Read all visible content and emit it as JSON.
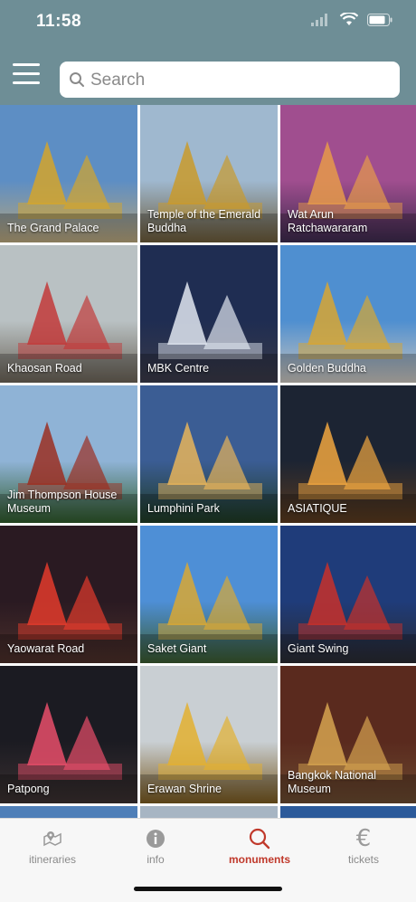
{
  "status": {
    "time": "11:58"
  },
  "header": {
    "search_placeholder": "Search"
  },
  "monuments": [
    {
      "label": "The Grand Palace",
      "sky": "#5d8ec4",
      "ground": "#b7a47a",
      "accent": "#d4a52b"
    },
    {
      "label": "Temple of the Emerald Buddha",
      "sky": "#9fb8cf",
      "ground": "#6b5a38",
      "accent": "#c99a2c"
    },
    {
      "label": "Wat Arun Ratchawararam",
      "sky": "#a04e8f",
      "ground": "#3c2a4d",
      "accent": "#e69a4a"
    },
    {
      "label": "Khaosan Road",
      "sky": "#b9c1c3",
      "ground": "#6b6357",
      "accent": "#c23a3a"
    },
    {
      "label": "MBK Centre",
      "sky": "#1f2d52",
      "ground": "#3a3a48",
      "accent": "#e0e6f0"
    },
    {
      "label": "Golden Buddha",
      "sky": "#4f8fd0",
      "ground": "#c9c4bd",
      "accent": "#d7a632"
    },
    {
      "label": "Jim Thompson House Museum",
      "sky": "#8fb3d6",
      "ground": "#2f5a2a",
      "accent": "#9b2f22"
    },
    {
      "label": "Lumphini Park",
      "sky": "#3b5d94",
      "ground": "#1e3a22",
      "accent": "#e7b45a"
    },
    {
      "label": "ASIATIQUE",
      "sky": "#1c2433",
      "ground": "#5a3a1e",
      "accent": "#f0a640"
    },
    {
      "label": "Yaowarat  Road",
      "sky": "#2a1a22",
      "ground": "#4b2f2a",
      "accent": "#e33b2c"
    },
    {
      "label": "Saket Giant",
      "sky": "#4e8fd6",
      "ground": "#3a5a2e",
      "accent": "#d9a834"
    },
    {
      "label": "Giant Swing",
      "sky": "#1f3c7a",
      "ground": "#2a2a30",
      "accent": "#c8302a"
    },
    {
      "label": "Patpong",
      "sky": "#1b1b22",
      "ground": "#3a3030",
      "accent": "#e84d6a"
    },
    {
      "label": "Erawan Shrine",
      "sky": "#c9cfd3",
      "ground": "#7a5a20",
      "accent": "#e3b030"
    },
    {
      "label": "Bangkok National Museum",
      "sky": "#5a2a1e",
      "ground": "#6a4a30",
      "accent": "#d6a350"
    },
    {
      "label": "",
      "sky": "#4f7fb8",
      "ground": "#4f7fb8",
      "accent": "#d9b14a"
    },
    {
      "label": "",
      "sky": "#a7b5c3",
      "ground": "#a7b5c3",
      "accent": "#e0e0e0"
    },
    {
      "label": "",
      "sky": "#2c5a9a",
      "ground": "#2c5a9a",
      "accent": "#c8302a"
    }
  ],
  "tabs": [
    {
      "label": "itineraries",
      "icon": "map-pin-icon",
      "active": false
    },
    {
      "label": "info",
      "icon": "info-icon",
      "active": false
    },
    {
      "label": "monuments",
      "icon": "search-icon",
      "active": true
    },
    {
      "label": "tickets",
      "icon": "euro-icon",
      "active": false
    }
  ],
  "colors": {
    "header": "#6e8e96",
    "active_tab": "#c0392b",
    "inactive_tab": "#8a8a8a"
  }
}
